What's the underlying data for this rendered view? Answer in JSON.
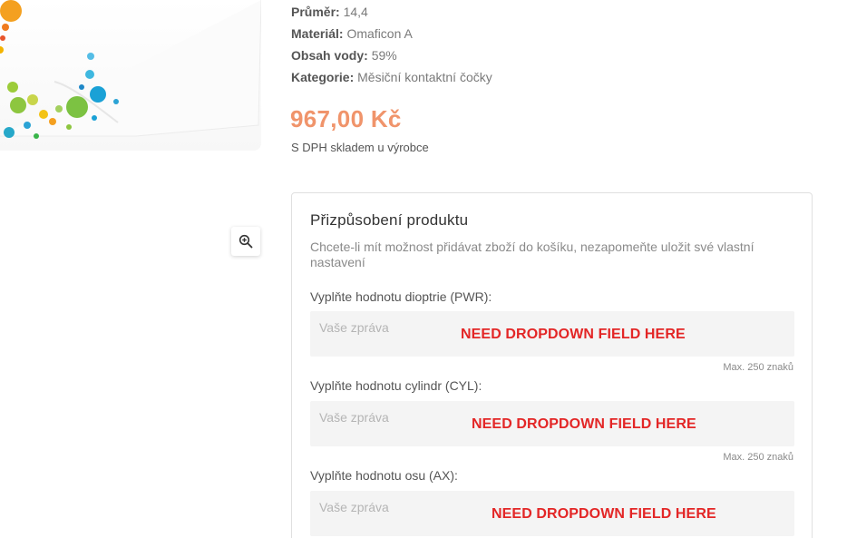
{
  "specs": [
    {
      "key": "Průměr:",
      "value": "14,4"
    },
    {
      "key": "Materiál:",
      "value": "Omaficon A"
    },
    {
      "key": "Obsah vody:",
      "value": "59%"
    },
    {
      "key": "Kategorie:",
      "value": "Měsiční kontaktní čočky"
    }
  ],
  "price": "967,00 Kč",
  "tax_note": "S DPH skladem u výrobce",
  "zoom_icon": "zoom-in-icon",
  "customization": {
    "title": "Přizpůsobení produktu",
    "description": "Chcete-li mít možnost přidávat zboží do košíku, nezapomeňte uložit své vlastní nastavení",
    "fields": [
      {
        "label": "Vyplňte hodnotu dioptrie (PWR):",
        "placeholder": "Vaše zpráva",
        "note": "NEED DROPDOWN FIELD HERE",
        "limit": "Max. 250 znaků"
      },
      {
        "label": "Vyplňte hodnotu cylindr (CYL):",
        "placeholder": "Vaše zpráva",
        "note": "NEED DROPDOWN FIELD HERE",
        "limit": "Max. 250 znaků"
      },
      {
        "label": "Vyplňte hodnotu osu (AX):",
        "placeholder": "Vaše zpráva",
        "note": "NEED DROPDOWN FIELD HERE",
        "limit": ""
      }
    ]
  },
  "colors": {
    "price": "#f0946b",
    "note": "#e32626",
    "field_bg": "#f4f4f4"
  }
}
